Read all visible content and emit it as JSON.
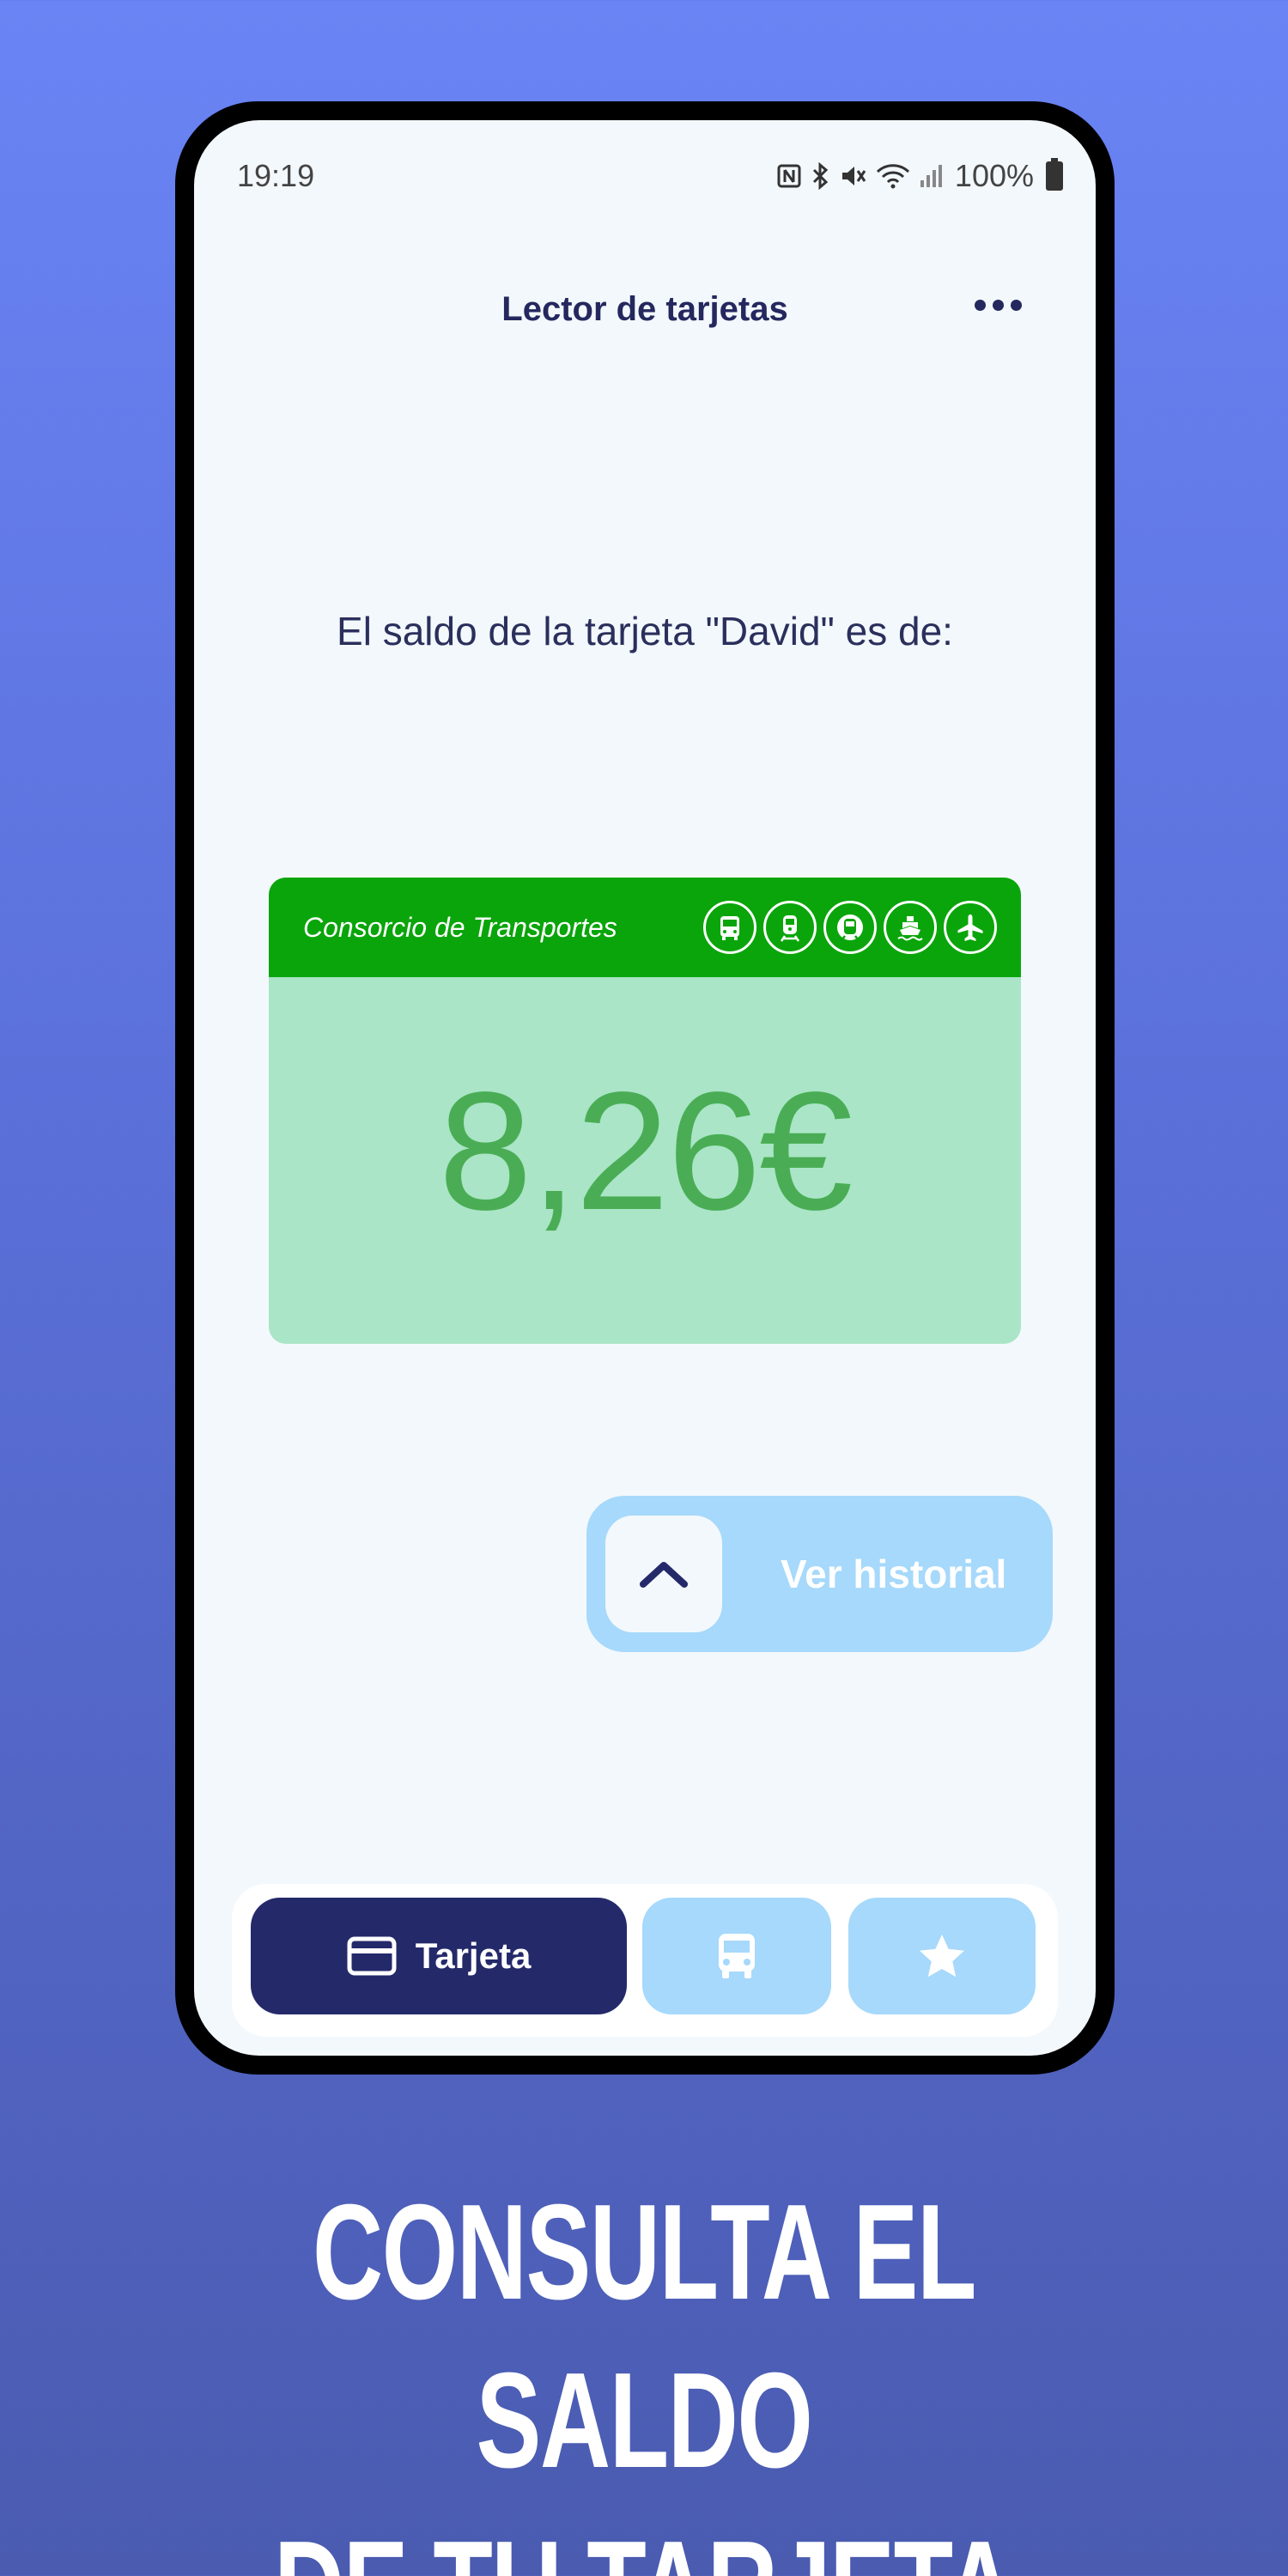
{
  "status_bar": {
    "time": "19:19",
    "battery": "100%",
    "icons": [
      "nfc-icon",
      "bluetooth-icon",
      "mute-icon",
      "wifi-icon",
      "signal-icon",
      "battery-icon"
    ]
  },
  "header": {
    "title": "Lector de tarjetas",
    "menu_icon": "more-horizontal-icon"
  },
  "balance": {
    "message": "El saldo de la tarjeta \"David\" es de:"
  },
  "card": {
    "brand": "Consorcio de Transportes",
    "amount": "8,26€",
    "mode_icons": [
      "bus-icon",
      "train-icon",
      "metro-icon",
      "ferry-icon",
      "plane-icon"
    ],
    "colors": {
      "band": "#0aa50a",
      "body": "#a9e5c6",
      "amount": "#4aad55"
    }
  },
  "history_button": {
    "label": "Ver historial",
    "icon": "chevron-up-icon"
  },
  "bottom_nav": [
    {
      "label": "Tarjeta",
      "icon": "card-icon",
      "active": true
    },
    {
      "label": "",
      "icon": "bus-icon",
      "active": false
    },
    {
      "label": "",
      "icon": "star-icon",
      "active": false
    }
  ],
  "promo": {
    "line1": "CONSULTA EL SALDO",
    "line2": "DE TU TARJETA"
  },
  "colors": {
    "accent": "#24296a",
    "light_blue": "#a6d9fb",
    "background": "#6a84f5"
  }
}
